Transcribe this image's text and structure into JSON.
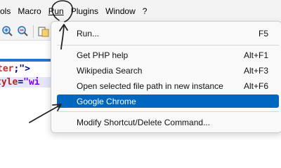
{
  "menubar": {
    "items": [
      "ols",
      "Macro",
      "Run",
      "Plugins",
      "Window",
      "?"
    ],
    "active": "Run"
  },
  "toolbar": {
    "icons": [
      "zoom-in-icon",
      "zoom-out-icon",
      "sync-view-icon"
    ]
  },
  "editor": {
    "line1": {
      "a": "ter",
      "b": ";\">"
    },
    "line2": {
      "attr": "tyle",
      "eq": "=",
      "str": "\"wi"
    }
  },
  "run_menu": {
    "items": [
      {
        "label": "Run...",
        "shortcut": "F5"
      },
      {
        "label": "Get PHP help",
        "shortcut": "Alt+F1"
      },
      {
        "label": "Wikipedia Search",
        "shortcut": "Alt+F3"
      },
      {
        "label": "Open selected file path in new instance",
        "shortcut": "Alt+F6"
      },
      {
        "label": "Google Chrome",
        "shortcut": ""
      },
      {
        "label": "Modify Shortcut/Delete Command...",
        "shortcut": ""
      }
    ],
    "highlighted_index": 4
  },
  "colors": {
    "highlight": "#0067c0",
    "ink": "#222222",
    "menubar_bg": "#f3f3f3"
  }
}
